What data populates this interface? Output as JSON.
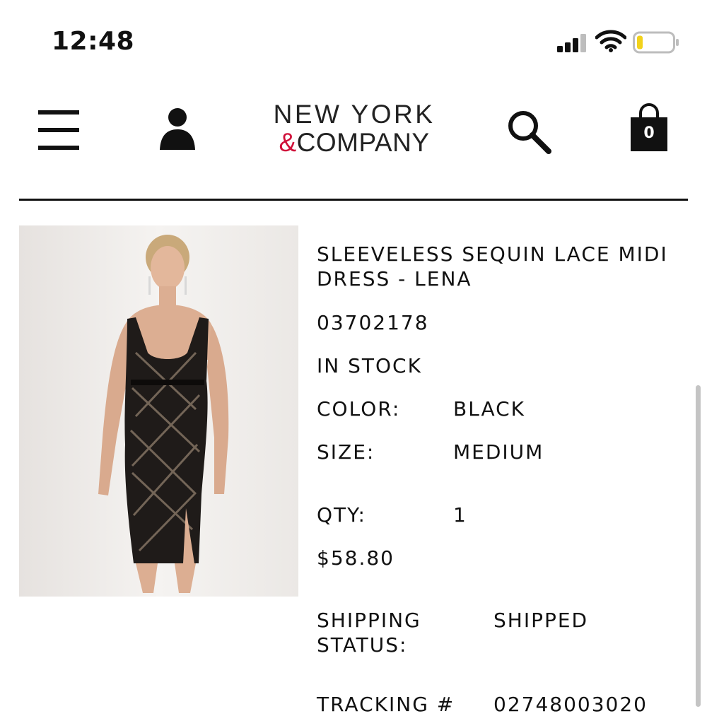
{
  "status_bar": {
    "time": "12:48"
  },
  "brand": {
    "line1": "NEW YORK",
    "amp": "&",
    "line2": "COMPANY",
    "accent_color": "#d0103a"
  },
  "cart": {
    "count": "0"
  },
  "icons": {
    "menu": "hamburger-menu-icon",
    "account": "user-icon",
    "search": "search-icon",
    "cart": "shopping-bag-icon"
  },
  "product": {
    "title": "SLEEVELESS SEQUIN LACE MIDI DRESS - LENA",
    "sku": "03702178",
    "stock_status": "IN STOCK",
    "color_label": "COLOR:",
    "color_value": "BLACK",
    "size_label": "SIZE:",
    "size_value": "MEDIUM",
    "qty_label": "QTY:",
    "qty_value": "1",
    "price": "$58.80",
    "shipping_label_1": "SHIPPING",
    "shipping_label_2": "STATUS:",
    "shipping_value": "SHIPPED",
    "tracking_label": "TRACKING #",
    "tracking_value": "02748003020"
  }
}
